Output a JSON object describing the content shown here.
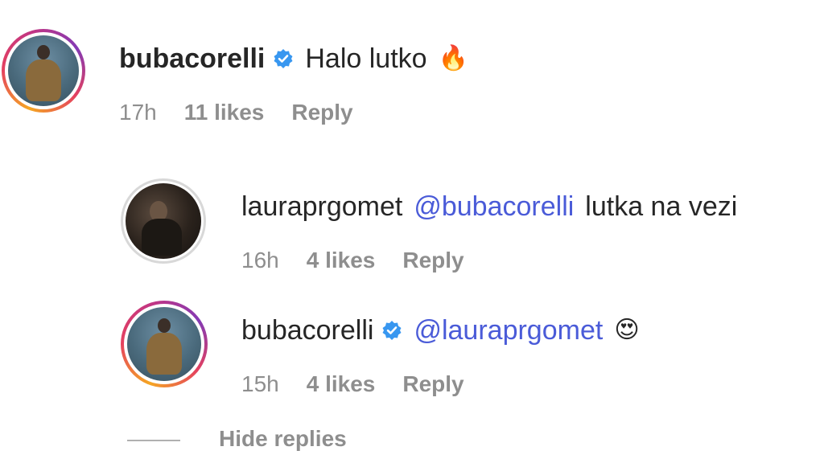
{
  "comments": [
    {
      "username": "bubacorelli",
      "verified": true,
      "text": "Halo lutko",
      "mention": "",
      "emoji": "🔥",
      "emoji_name": "fire-emoji",
      "time": "17h",
      "likes": "11 likes",
      "reply": "Reply"
    },
    {
      "username": "lauraprgomet",
      "verified": false,
      "mention": "@bubacorelli",
      "text": "lutka na vezi",
      "time": "16h",
      "likes": "4 likes",
      "reply": "Reply"
    },
    {
      "username": "bubacorelli",
      "verified": true,
      "mention": "@lauraprgomet",
      "text": "",
      "emoji": "😍",
      "emoji_name": "heart-eyes-emoji",
      "time": "15h",
      "likes": "4 likes",
      "reply": "Reply"
    }
  ],
  "hide_replies": "Hide replies",
  "colors": {
    "verified_badge": "#3897f0",
    "mention": "#4a5bd8",
    "meta": "#8e8e8e"
  }
}
